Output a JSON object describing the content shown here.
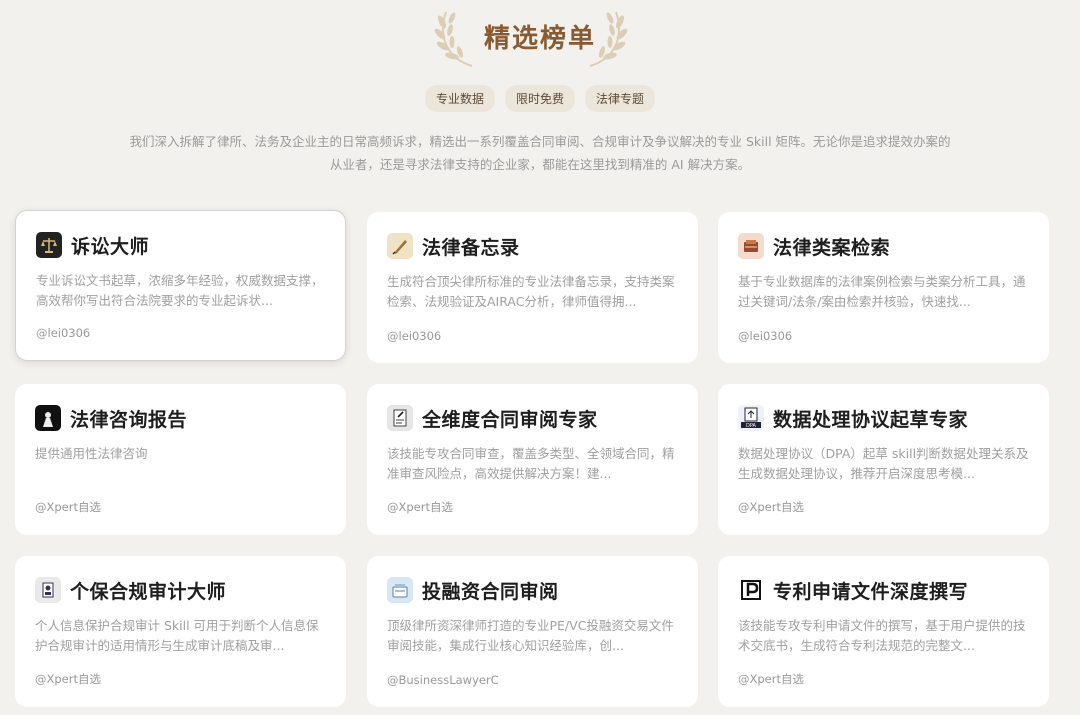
{
  "header": {
    "title": "精选榜单",
    "tags": [
      "专业数据",
      "限时免费",
      "法律专题"
    ],
    "description_line1": "我们深入拆解了律所、法务及企业主的日常高频诉求，精选出一系列覆盖合同审阅、合规审计及争议解决的专业 Skill 矩阵。无论你是追求提效办案的",
    "description_line2": "从业者，还是寻求法律支持的企业家，都能在这里找到精准的 AI 解决方案。"
  },
  "colors": {
    "accent": "#8a5a32",
    "tag_bg": "#ebe5da",
    "page_bg": "#f3f1ed"
  },
  "cards": [
    {
      "title": "诉讼大师",
      "desc": "专业诉讼文书起草，浓缩多年经验，权威数据支撑，高效帮你写出符合法院要求的专业起诉状...",
      "author": "@lei0306",
      "icon": "scales-of-justice-icon"
    },
    {
      "title": "法律备忘录",
      "desc": "生成符合顶尖律所标准的专业法律备忘录，支持类案检索、法规验证及AIRAC分析，律师值得拥...",
      "author": "@lei0306",
      "icon": "quill-pen-icon"
    },
    {
      "title": "法律类案检索",
      "desc": "基于专业数据库的法律案例检索与类案分析工具，通过关键词/法条/案由检索并核验，快速找...",
      "author": "@lei0306",
      "icon": "law-book-icon"
    },
    {
      "title": "法律咨询报告",
      "desc": "提供通用性法律咨询",
      "author": "@Xpert自选",
      "icon": "lawyer-portrait-icon"
    },
    {
      "title": "全维度合同审阅专家",
      "desc": "该技能专攻合同审查，覆盖多类型、全领域合同，精准审查风险点，高效提供解决方案！建...",
      "author": "@Xpert自选",
      "icon": "contract-review-icon"
    },
    {
      "title": "数据处理协议起草专家",
      "desc": "数据处理协议（DPA）起草 skill判断数据处理关系及生成数据处理协议，推荐开启深度思考模...",
      "author": "@Xpert自选",
      "icon": "dpa-document-icon"
    },
    {
      "title": "个保合规审计大师",
      "desc": "个人信息保护合规审计 Skill 可用于判断个人信息保护合规审计的适用情形与生成审计底稿及审...",
      "author": "@Xpert自选",
      "icon": "privacy-audit-icon"
    },
    {
      "title": "投融资合同审阅",
      "desc": "顶级律所资深律师打造的专业PE/VC投融资交易文件审阅技能，集成行业核心知识经验库，创...",
      "author": "@BusinessLawyerC",
      "icon": "investment-docs-icon"
    },
    {
      "title": "专利申请文件深度撰写",
      "desc": "该技能专攻专利申请文件的撰写，基于用户提供的技术交底书，生成符合专利法规范的完整文...",
      "author": "@Xpert自选",
      "icon": "patent-p-icon"
    }
  ]
}
